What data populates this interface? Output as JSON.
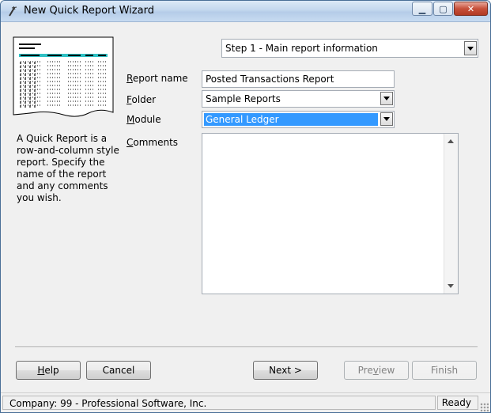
{
  "window": {
    "title": "New Quick Report Wizard",
    "minimize_glyph": "▁",
    "maximize_glyph": "▢",
    "close_glyph": "✕"
  },
  "step": {
    "selected": "Step 1 - Main report information"
  },
  "description": "A Quick Report is a row-and-column style report. Specify the name of the report and any comments you wish.",
  "form": {
    "report_name": {
      "label_key": "R",
      "label_rest": "eport name",
      "value": "Posted Transactions Report"
    },
    "folder": {
      "label_key": "F",
      "label_rest": "older",
      "value": "Sample Reports"
    },
    "module": {
      "label_key": "M",
      "label_rest": "odule",
      "value": "General Ledger"
    },
    "comments": {
      "label_key": "C",
      "label_rest": "omments",
      "value": ""
    }
  },
  "buttons": {
    "help": {
      "key": "H",
      "rest": "elp"
    },
    "cancel": "Cancel",
    "next": "Next >",
    "preview": {
      "pre": "Pre",
      "key": "v",
      "rest": "iew"
    },
    "finish": "Finish"
  },
  "status": {
    "company": "Company: 99 - Professional Software, Inc.",
    "state": "Ready"
  },
  "icons": {
    "title": "wizard-wand-icon",
    "preview": "report-document-icon"
  }
}
